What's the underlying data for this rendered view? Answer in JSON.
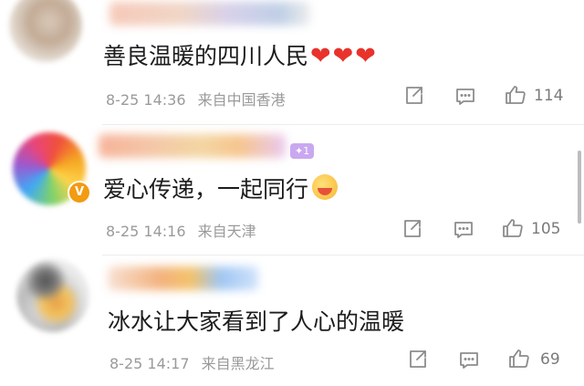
{
  "comments": [
    {
      "text": "善良温暖的四川人民",
      "date": "8-25",
      "time": "14:36",
      "location": "来自中国香港",
      "like_count": "114"
    },
    {
      "level_badge": "1",
      "text": "爱心传递，一起同行",
      "date": "8-25",
      "time": "14:16",
      "location": "来自天津",
      "like_count": "105"
    },
    {
      "text": "冰水让大家看到了人心的温暖",
      "date": "8-25",
      "time": "14:17",
      "location": "来自黑龙江",
      "like_count": "69"
    }
  ],
  "icons": {
    "share": "share-icon",
    "comment": "comment-icon",
    "like": "thumbs-up-icon",
    "heart": "red-heart-emoji",
    "hug": "hug-emoji",
    "verified": "verified-badge-icon"
  },
  "colors": {
    "heart": "#e8322b",
    "meta_text": "#9a9a9a",
    "verified_badge": "#f29b13",
    "level_badge": "#c9a8f0"
  }
}
